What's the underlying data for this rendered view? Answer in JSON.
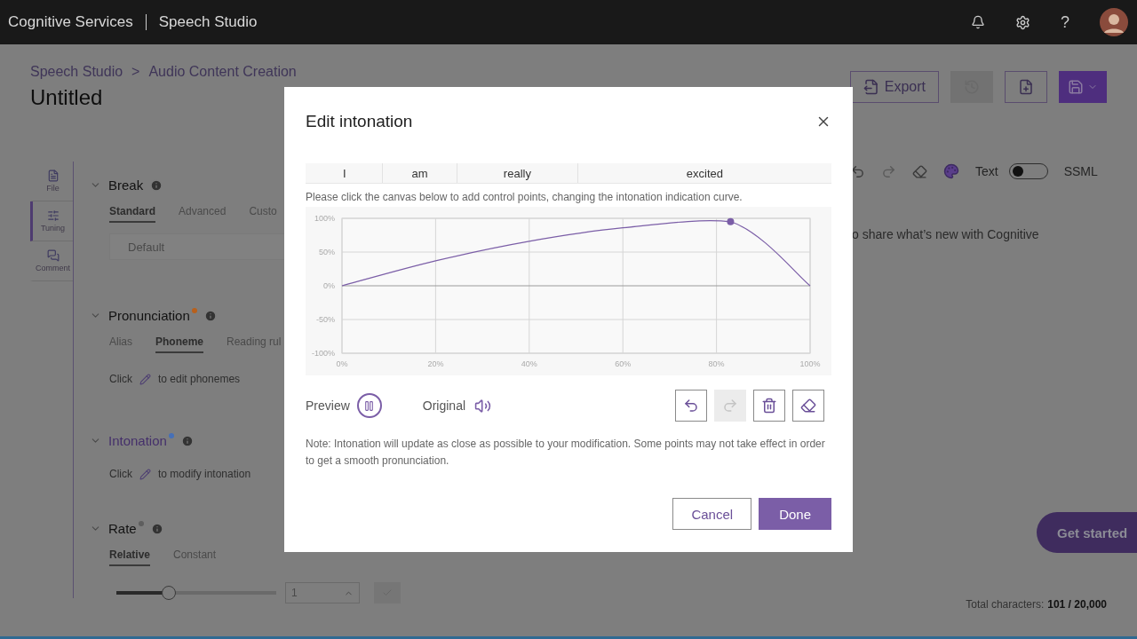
{
  "header": {
    "brand": "Cognitive Services",
    "product": "Speech Studio",
    "help": "?"
  },
  "breadcrumb": [
    "Speech Studio",
    "Audio Content Creation"
  ],
  "breadcrumb_separator": ">",
  "page_title": "Untitled",
  "toolbar": {
    "export": "Export",
    "history_disabled": true
  },
  "side_tabs": [
    {
      "label": "File",
      "selected": false
    },
    {
      "label": "Tuning",
      "selected": true
    },
    {
      "label": "Comment",
      "selected": false
    }
  ],
  "sections": [
    {
      "title": "Break",
      "active": false,
      "tabs": [
        {
          "label": "Standard",
          "selected": true
        },
        {
          "label": "Advanced",
          "selected": false
        },
        {
          "label": "Custo",
          "selected": false
        }
      ],
      "field": "Default"
    },
    {
      "title": "Pronunciation",
      "active": false,
      "color": "#b8601c",
      "tabs": [
        {
          "label": "Alias",
          "selected": false
        },
        {
          "label": "Phoneme",
          "selected": true
        },
        {
          "label": "Reading rul",
          "selected": false
        }
      ],
      "hint": [
        "Click",
        "to edit phonemes"
      ]
    },
    {
      "title": "Intonation",
      "active": true,
      "color": "#4670b8",
      "hint": [
        "Click",
        "to modify intonation"
      ]
    },
    {
      "title": "Rate",
      "active": false,
      "color": "#5e5e5e",
      "tabs": [
        {
          "label": "Relative",
          "selected": true
        },
        {
          "label": "Constant",
          "selected": false
        }
      ],
      "slider": {
        "level": 0.33,
        "value": "1"
      }
    }
  ],
  "editor": {
    "text_label": "Text",
    "ssml_label": "SSML",
    "ssml_on": false,
    "content": "o share what’s new with Cognitive",
    "get_started": "Get started",
    "total_label": "Total characters:",
    "total_value": "101 / 20,000"
  },
  "dialog": {
    "title": "Edit intonation",
    "words": [
      "I",
      "am",
      "really",
      "excited"
    ],
    "instruction": "Please click the canvas below to add control points, changing the intonation indication curve.",
    "chart_data": {
      "type": "line",
      "x": [
        0,
        20,
        40,
        60,
        83,
        100
      ],
      "series": [
        {
          "color": "#7b5ea7",
          "values": [
            0,
            37,
            66,
            86,
            95,
            0
          ]
        }
      ],
      "xlim": [
        0,
        100
      ],
      "ylim": [
        -100,
        100
      ],
      "grid": true,
      "xticks": [
        {
          "value": 0,
          "label": "0%"
        },
        {
          "value": 20,
          "label": "20%"
        },
        {
          "value": 40,
          "label": "40%"
        },
        {
          "value": 60,
          "label": "60%"
        },
        {
          "value": 80,
          "label": "80%"
        },
        {
          "value": 100,
          "label": "100%"
        }
      ],
      "yticks": [
        {
          "value": 100,
          "label": "100%"
        },
        {
          "value": 50,
          "label": "50%"
        },
        {
          "value": 0,
          "label": "0%"
        },
        {
          "value": -50,
          "label": "-50%"
        },
        {
          "value": -100,
          "label": "-100%"
        }
      ]
    },
    "preview_label": "Preview",
    "preview_playing": true,
    "original_label": "Original",
    "redo_disabled": true,
    "note": "Note: Intonation will update as close as possible to your modification. Some points may not take effect in order to get a smooth pronunciation.",
    "cancel": "Cancel",
    "done": "Done"
  }
}
